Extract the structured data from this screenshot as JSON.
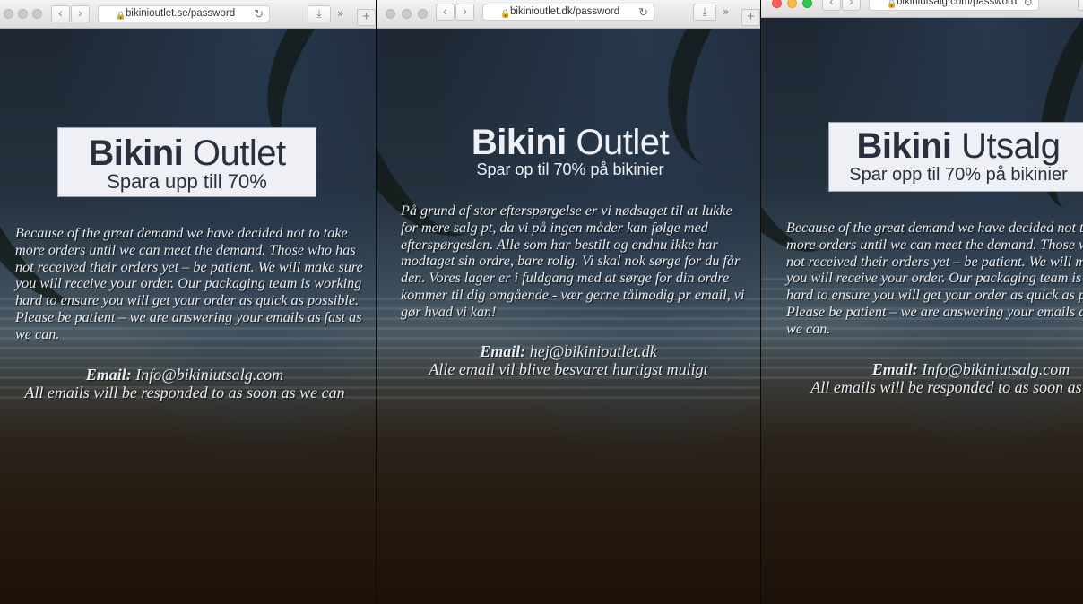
{
  "windows": [
    {
      "url": "bikinioutlet.se/password",
      "logo": {
        "bold": "Bikini",
        "light": "Outlet",
        "subtitle": "Spara upp till 70%"
      },
      "message": "Because of the great demand we have decided not to take more orders until we can meet the demand. Those who has not received their orders yet – be patient. We will make sure you will receive your order. Our packaging team is working hard to ensure you will get your order as quick as possible. Please be patient – we are answering your emails as fast as we can.",
      "email_label": "Email:",
      "email": "Info@bikiniutsalg.com",
      "response_note": "All emails will be responded to as soon as we can"
    },
    {
      "url": "bikinioutlet.dk/password",
      "logo": {
        "bold": "Bikini",
        "light": "Outlet",
        "subtitle": "Spar op til 70% på bikinier"
      },
      "message": "På grund af stor efterspørgelse er vi nødsaget til at lukke for mere salg pt, da vi på ingen måder kan følge med efterspørgeslen. Alle som har bestilt og endnu ikke har modtaget sin ordre, bare rolig. Vi skal nok sørge for du får den. Vores lager er i fuldgang med at sørge for din ordre kommer til dig omgående - vær gerne tålmodig pr email, vi gør hvad vi kan!",
      "email_label": "Email:",
      "email": "hej@bikinioutlet.dk",
      "response_note": "Alle email vil blive besvaret hurtigst muligt"
    },
    {
      "url": "bikiniutsalg.com/password",
      "logo": {
        "bold": "Bikini",
        "light": "Utsalg",
        "subtitle": "Spar opp til 70% på bikinier"
      },
      "message": "Because of the great demand we have decided not to take more orders until we can meet the demand. Those who has not received their orders yet – be patient. We will make sure you will receive your order. Our packaging team is working hard to ensure you will get your order as quick as possible. Please be patient – we are answering your emails as fast as we can.",
      "email_label": "Email:",
      "email": "Info@bikiniutsalg.com",
      "response_note": "All emails will be responded to as soon as we can"
    }
  ],
  "icons": {
    "back": "chevron-left-icon",
    "forward": "chevron-right-icon",
    "lock": "lock-icon",
    "reload": "reload-icon",
    "download": "download-icon",
    "overflow": "double-chevron-icon",
    "new_tab": "plus-icon"
  },
  "colors": {
    "close": "#fc605c",
    "minimize": "#fdbc40",
    "zoom": "#34c84a"
  }
}
